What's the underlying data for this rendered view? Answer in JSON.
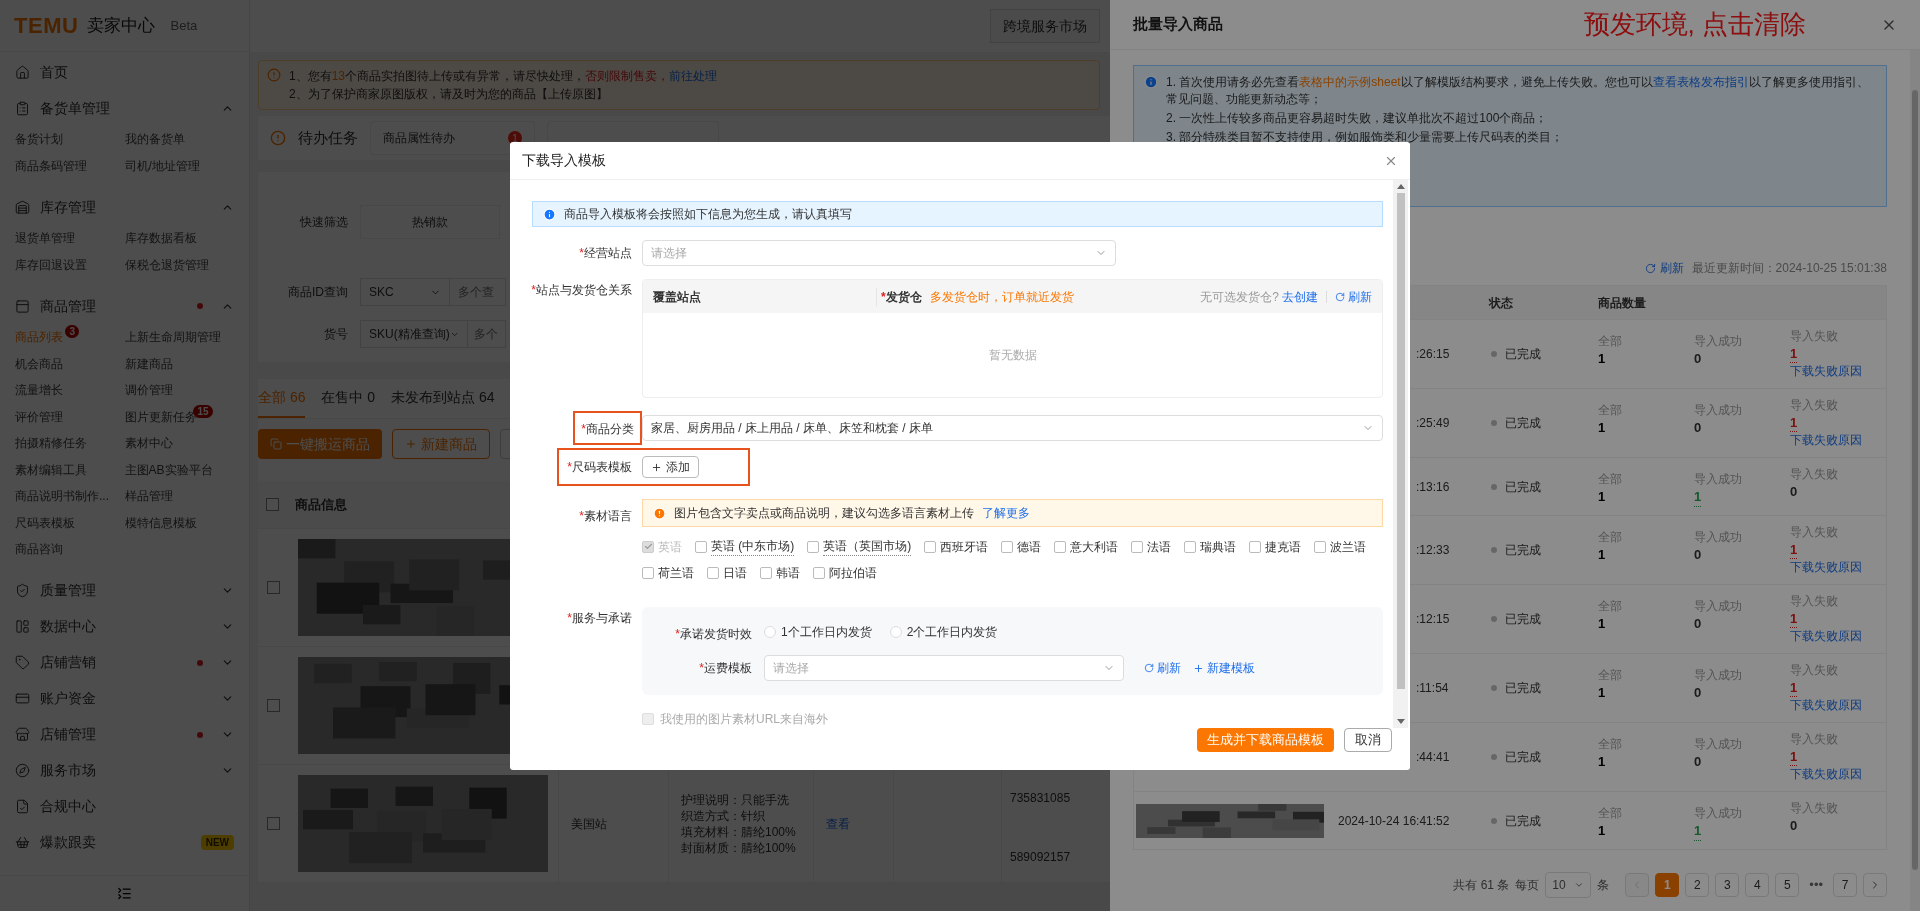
{
  "app": {
    "logo": "TEMU",
    "title": "卖家中心",
    "tag": "Beta"
  },
  "sidebar": {
    "items": [
      {
        "kind": "link",
        "label": "首页",
        "dot": false
      },
      {
        "kind": "group",
        "label": "备货单管理",
        "expanded": true,
        "dot": false,
        "children": [
          {
            "label": "备货计划",
            "selected": false
          },
          {
            "label": "我的备货单",
            "selected": false
          },
          {
            "label": "商品条码管理",
            "selected": false
          },
          {
            "label": "司机/地址管理",
            "selected": false
          }
        ]
      },
      {
        "kind": "group",
        "label": "库存管理",
        "expanded": true,
        "dot": false,
        "children": [
          {
            "label": "退货单管理",
            "selected": false
          },
          {
            "label": "库存数据看板",
            "selected": false
          },
          {
            "label": "库存回退设置",
            "selected": false
          },
          {
            "label": "保税仓退货管理",
            "selected": false
          }
        ]
      },
      {
        "kind": "group",
        "label": "商品管理",
        "expanded": true,
        "dot": true,
        "children": [
          {
            "label": "商品列表",
            "selected": true,
            "badge": "3"
          },
          {
            "label": "上新生命周期管理",
            "selected": false
          },
          {
            "label": "机会商品",
            "selected": false
          },
          {
            "label": "新建商品",
            "selected": false
          },
          {
            "label": "流量增长",
            "selected": false
          },
          {
            "label": "调价管理",
            "selected": false
          },
          {
            "label": "评价管理",
            "selected": false
          },
          {
            "label": "图片更新任务",
            "selected": false,
            "badge": "15"
          },
          {
            "label": "拍摄精修任务",
            "selected": false
          },
          {
            "label": "素材中心",
            "selected": false
          },
          {
            "label": "素材编辑工具",
            "selected": false
          },
          {
            "label": "主图AB实验平台",
            "selected": false
          },
          {
            "label": "商品说明书制作...",
            "selected": false
          },
          {
            "label": "样品管理",
            "selected": false
          },
          {
            "label": "尺码表模板",
            "selected": false
          },
          {
            "label": "模特信息模板",
            "selected": false
          },
          {
            "label": "商品咨询",
            "selected": false
          }
        ]
      },
      {
        "kind": "group",
        "label": "质量管理",
        "expanded": false,
        "dot": false
      },
      {
        "kind": "group",
        "label": "数据中心",
        "expanded": false,
        "dot": false
      },
      {
        "kind": "group",
        "label": "店铺营销",
        "expanded": false,
        "dot": true
      },
      {
        "kind": "group",
        "label": "账户资金",
        "expanded": false,
        "dot": false
      },
      {
        "kind": "group",
        "label": "店铺管理",
        "expanded": false,
        "dot": true
      },
      {
        "kind": "group",
        "label": "服务市场",
        "expanded": false,
        "dot": false
      },
      {
        "kind": "link",
        "label": "合规中心",
        "dot": false
      },
      {
        "kind": "link",
        "label": "爆款跟卖",
        "dot": false,
        "badge": "NEW"
      }
    ]
  },
  "main": {
    "top_button": "跨境服务市场",
    "notice": {
      "before": "1、您有",
      "count": "13",
      "middle": "个商品实拍图待上传或有异常，请尽快处理，",
      "warning": "否则限制售卖，",
      "link": "前往处理",
      "line2": "2、为了保护商家原图版权，请及时为您的商品【上传原图】"
    },
    "todo": {
      "title": "待办任务",
      "cards": [
        {
          "label": "商品属性待办",
          "badge": "1"
        }
      ]
    },
    "filters": {
      "quick_label": "快速筛选",
      "quick_chip": "热销款",
      "id_label": "商品ID查询",
      "id_select": "SKC",
      "id_placeholder": "多个查",
      "sku_label": "货号",
      "sku_select": "SKU(精准查询)",
      "sku_placeholder": "多个"
    },
    "tabs": [
      {
        "label": "全部 66",
        "selected": true
      },
      {
        "label": "在售中 0",
        "selected": false
      },
      {
        "label": "未发布到站点 64",
        "selected": false
      }
    ],
    "actions": [
      {
        "label": "一键搬运商品",
        "kind": "primary"
      },
      {
        "label": "新建商品",
        "kind": "add"
      }
    ],
    "table": {
      "columns": [
        "商品信息"
      ],
      "header_checked": false,
      "rows": [
        {
          "kind": "picture",
          "checked": false
        },
        {
          "kind": "picture",
          "checked": false
        },
        {
          "kind": "detail",
          "checked": false,
          "site": "美国站",
          "attributes": [
            "护理说明：只能手洗",
            "织造方式：针织",
            "填充材料：腈纶100%",
            "封面材质：腈纶100%"
          ],
          "link": "查看",
          "ids": [
            "735831085",
            "589092157"
          ]
        }
      ]
    }
  },
  "drawer": {
    "title": "批量导入商品",
    "env_note": "预发环境, 点击清除",
    "notice": {
      "line1_before": "1. 首次使用请务必先查看",
      "line1_link1": "表格中的示例sheet",
      "line1_middle": "以了解模版结构要求，避免上传失败。您也可以",
      "line1_link2": "查看表格发布指引",
      "line1_after": "以了解更多使用指引、常见问题、功能更新动态等；",
      "lines": [
        "2. 一次性上传较多商品更容易超时失败，建议单批次不超过100个商品；",
        "3. 部分特殊类目暂不支持使用，例如服饰类和少量需要上传尺码表的类目；"
      ]
    },
    "refresh": "刷新",
    "updated": "最近更新时间：2024-10-25 15:01:38",
    "columns": [
      "状态",
      "商品数量"
    ],
    "rows": [
      {
        "kind": "partial",
        "time": ":26:15",
        "status": "已完成",
        "total_label": "全部",
        "total": "1",
        "success_label": "导入成功",
        "success": "0",
        "success_ok": false,
        "fail_label": "导入失败",
        "fail": "1",
        "failed": true,
        "fail_link": "下载失败原因"
      },
      {
        "kind": "partial",
        "time": ":25:49",
        "status": "已完成",
        "total_label": "全部",
        "total": "1",
        "success_label": "导入成功",
        "success": "0",
        "success_ok": false,
        "fail_label": "导入失败",
        "fail": "1",
        "failed": true,
        "fail_link": "下载失败原因"
      },
      {
        "kind": "partial",
        "time": ":13:16",
        "status": "已完成",
        "total_label": "全部",
        "total": "1",
        "success_label": "导入成功",
        "success": "1",
        "success_ok": true,
        "fail_label": "导入失败",
        "fail": "0",
        "failed": false
      },
      {
        "kind": "partial",
        "time": ":12:33",
        "status": "已完成",
        "total_label": "全部",
        "total": "1",
        "success_label": "导入成功",
        "success": "0",
        "success_ok": false,
        "fail_label": "导入失败",
        "fail": "1",
        "failed": true,
        "fail_link": "下载失败原因"
      },
      {
        "kind": "partial",
        "time": ":12:15",
        "status": "已完成",
        "total_label": "全部",
        "total": "1",
        "success_label": "导入成功",
        "success": "0",
        "success_ok": false,
        "fail_label": "导入失败",
        "fail": "1",
        "failed": true,
        "fail_link": "下载失败原因"
      },
      {
        "kind": "partial",
        "time": ":11:54",
        "status": "已完成",
        "total_label": "全部",
        "total": "1",
        "success_label": "导入成功",
        "success": "0",
        "success_ok": false,
        "fail_label": "导入失败",
        "fail": "1",
        "failed": true,
        "fail_link": "下载失败原因"
      },
      {
        "kind": "partial",
        "time": ":44:41",
        "status": "已完成",
        "total_label": "全部",
        "total": "1",
        "success_label": "导入成功",
        "success": "0",
        "success_ok": false,
        "fail_label": "导入失败",
        "fail": "1",
        "failed": true,
        "fail_link": "下载失败原因"
      },
      {
        "kind": "full",
        "time": "2024-10-24 16:41:52",
        "status": "已完成",
        "total_label": "全部",
        "total": "1",
        "success_label": "导入成功",
        "success": "1",
        "success_ok": true,
        "fail_label": "导入失败",
        "fail": "0",
        "failed": false
      }
    ],
    "pagination": {
      "prev_disabled": true,
      "total": "共有 61 条",
      "per_page_label": "每页",
      "per_page": "10",
      "unit": "条",
      "pages": [
        {
          "kind": "page",
          "label": "1",
          "selected": true
        },
        {
          "kind": "page",
          "label": "2",
          "selected": false
        },
        {
          "kind": "page",
          "label": "3",
          "selected": false
        },
        {
          "kind": "page",
          "label": "4",
          "selected": false
        },
        {
          "kind": "page",
          "label": "5",
          "selected": false
        },
        {
          "kind": "ellipsis",
          "label": "•••"
        },
        {
          "kind": "page",
          "label": "7",
          "selected": false
        }
      ]
    }
  },
  "modal": {
    "title": "下载导入模板",
    "info": "商品导入模板将会按照如下信息为您生成，请认真填写",
    "site": {
      "required": "*",
      "label": "经营站点",
      "placeholder": "请选择"
    },
    "warehouse": {
      "required": "*",
      "label": "站点与发货仓关系",
      "col1": "覆盖站点",
      "col2_required": "*",
      "col2": "发货仓",
      "col2_note": "多发货仓时，订单就近发货",
      "none_text": "无可选发货仓?",
      "create": "去创建",
      "refresh": "刷新",
      "empty": "暂无数据"
    },
    "category": {
      "required": "*",
      "label": "商品分类",
      "value": "家居、厨房用品 / 床上用品 / 床单、床笠和枕套 / 床单",
      "highlighted": true
    },
    "size_chart": {
      "required": "*",
      "label": "尺码表模板",
      "button": "添加",
      "highlighted": true
    },
    "languages": {
      "required": "*",
      "label": "素材语言",
      "warning": "图片包含文字卖点或商品说明，建议勾选多语言素材上传",
      "link": "了解更多",
      "options": [
        {
          "label": "英语",
          "checked": true,
          "disabled": true,
          "tooltip": false
        },
        {
          "label": "英语 (中东市场)",
          "checked": false,
          "disabled": false,
          "tooltip": true
        },
        {
          "label": "英语（英国市场)",
          "checked": false,
          "disabled": false,
          "tooltip": true
        },
        {
          "label": "西班牙语",
          "checked": false,
          "disabled": false,
          "tooltip": false
        },
        {
          "label": "德语",
          "checked": false,
          "disabled": false,
          "tooltip": false
        },
        {
          "label": "意大利语",
          "checked": false,
          "disabled": false,
          "tooltip": false
        },
        {
          "label": "法语",
          "checked": false,
          "disabled": false,
          "tooltip": false
        },
        {
          "label": "瑞典语",
          "checked": false,
          "disabled": false,
          "tooltip": false
        },
        {
          "label": "捷克语",
          "checked": false,
          "disabled": false,
          "tooltip": false
        },
        {
          "label": "波兰语",
          "checked": false,
          "disabled": false,
          "tooltip": false
        },
        {
          "label": "荷兰语",
          "checked": false,
          "disabled": false,
          "tooltip": false
        },
        {
          "label": "日语",
          "checked": false,
          "disabled": false,
          "tooltip": false
        },
        {
          "label": "韩语",
          "checked": false,
          "disabled": false,
          "tooltip": false
        },
        {
          "label": "阿拉伯语",
          "checked": false,
          "disabled": false,
          "tooltip": false
        }
      ]
    },
    "service": {
      "required": "*",
      "label": "服务与承诺",
      "ship_required": "*",
      "ship_label": "承诺发货时效",
      "ship_options": [
        {
          "label": "1个工作日内发货",
          "selected": false
        },
        {
          "label": "2个工作日内发货",
          "selected": false
        }
      ],
      "freight_required": "*",
      "freight_label": "运费模板",
      "freight_placeholder": "请选择",
      "refresh": "刷新",
      "create": "新建模板"
    },
    "overseas": {
      "label": "我使用的图片素材URL来自海外",
      "checked": false
    },
    "primary": "生成并下载商品模板",
    "cancel": "取消"
  }
}
